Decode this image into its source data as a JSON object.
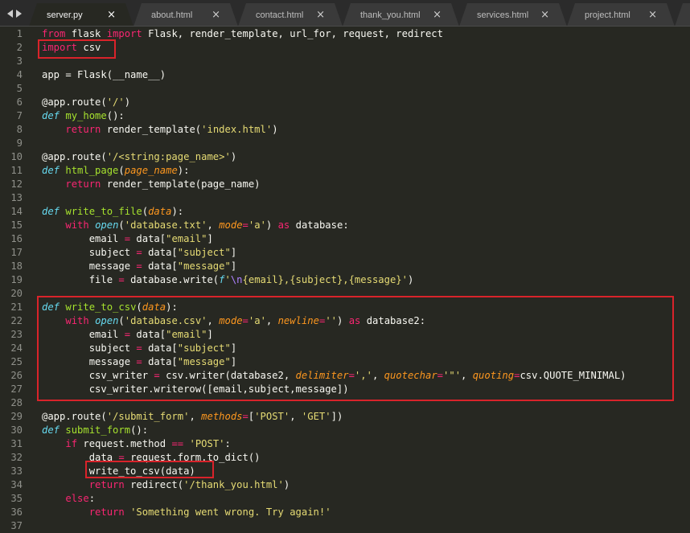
{
  "tabs": [
    {
      "label": "server.py",
      "active": true
    },
    {
      "label": "about.html",
      "active": false
    },
    {
      "label": "contact.html",
      "active": false
    },
    {
      "label": "thank_you.html",
      "active": false
    },
    {
      "label": "services.html",
      "active": false
    },
    {
      "label": "project.html",
      "active": false
    },
    {
      "label": "i",
      "active": false
    }
  ],
  "close_glyph": "×",
  "line_numbers": [
    "1",
    "2",
    "3",
    "4",
    "5",
    "6",
    "7",
    "8",
    "9",
    "10",
    "11",
    "12",
    "13",
    "14",
    "15",
    "16",
    "17",
    "18",
    "19",
    "20",
    "21",
    "22",
    "23",
    "24",
    "25",
    "26",
    "27",
    "28",
    "29",
    "30",
    "31",
    "32",
    "33",
    "34",
    "35",
    "36",
    "37"
  ],
  "code": {
    "l1": [
      "from",
      " flask ",
      "import",
      " Flask, render_template, url_for, request, redirect"
    ],
    "l2": [
      "import",
      " csv"
    ],
    "l4": [
      "app = Flask(__name__)"
    ],
    "l6": [
      "@app.route(",
      "'/'",
      ")"
    ],
    "l7": [
      "def",
      " ",
      "my_home",
      "():"
    ],
    "l8": [
      "    ",
      "return",
      " render_template(",
      "'index.html'",
      ")"
    ],
    "l10": [
      "@app.route(",
      "'/<string:page_name>'",
      ")"
    ],
    "l11": [
      "def",
      " ",
      "html_page",
      "(",
      "page_name",
      "):"
    ],
    "l12": [
      "    ",
      "return",
      " render_template(page_name)"
    ],
    "l14": [
      "def",
      " ",
      "write_to_file",
      "(",
      "data",
      "):"
    ],
    "l15": [
      "    ",
      "with",
      " ",
      "open",
      "(",
      "'database.txt'",
      ", ",
      "mode",
      "=",
      "'a'",
      ") ",
      "as",
      " database:"
    ],
    "l16": [
      "        email ",
      "=",
      " data[",
      "\"email\"",
      "]"
    ],
    "l17": [
      "        subject ",
      "=",
      " data[",
      "\"subject\"",
      "]"
    ],
    "l18": [
      "        message ",
      "=",
      " data[",
      "\"message\"",
      "]"
    ],
    "l19": [
      "        file ",
      "=",
      " database.write(",
      "f",
      "'",
      "\\n",
      "{email},{subject},{message}'",
      ")"
    ],
    "l21": [
      "def",
      " ",
      "write_to_csv",
      "(",
      "data",
      "):"
    ],
    "l22": [
      "    ",
      "with",
      " ",
      "open",
      "(",
      "'database.csv'",
      ", ",
      "mode",
      "=",
      "'a'",
      ", ",
      "newline",
      "=",
      "''",
      ") ",
      "as",
      " database2:"
    ],
    "l23": [
      "        email ",
      "=",
      " data[",
      "\"email\"",
      "]"
    ],
    "l24": [
      "        subject ",
      "=",
      " data[",
      "\"subject\"",
      "]"
    ],
    "l25": [
      "        message ",
      "=",
      " data[",
      "\"message\"",
      "]"
    ],
    "l26": [
      "        csv_writer ",
      "=",
      " csv.writer(database2, ",
      "delimiter",
      "=",
      "','",
      ", ",
      "quotechar",
      "=",
      "'\"'",
      ", ",
      "quoting",
      "=",
      "csv.QUOTE_MINIMAL)"
    ],
    "l27": [
      "        csv_writer.writerow([email,subject,message])"
    ],
    "l29": [
      "@app.route(",
      "'/submit_form'",
      ", ",
      "methods",
      "=",
      "[",
      "'POST'",
      ", ",
      "'GET'",
      "])"
    ],
    "l30": [
      "def",
      " ",
      "submit_form",
      "():"
    ],
    "l31": [
      "    ",
      "if",
      " request.method ",
      "==",
      " ",
      "'POST'",
      ":"
    ],
    "l32": [
      "        data ",
      "=",
      " request.form.to_dict()"
    ],
    "l33": [
      "        write_to_csv(data)"
    ],
    "l34": [
      "        ",
      "return",
      " redirect(",
      "'/thank_you.html'",
      ")"
    ],
    "l35": [
      "    ",
      "else",
      ":"
    ],
    "l36": [
      "        ",
      "return",
      " ",
      "'Something went wrong. Try again!'"
    ]
  },
  "highlight_color": "#d9232a"
}
